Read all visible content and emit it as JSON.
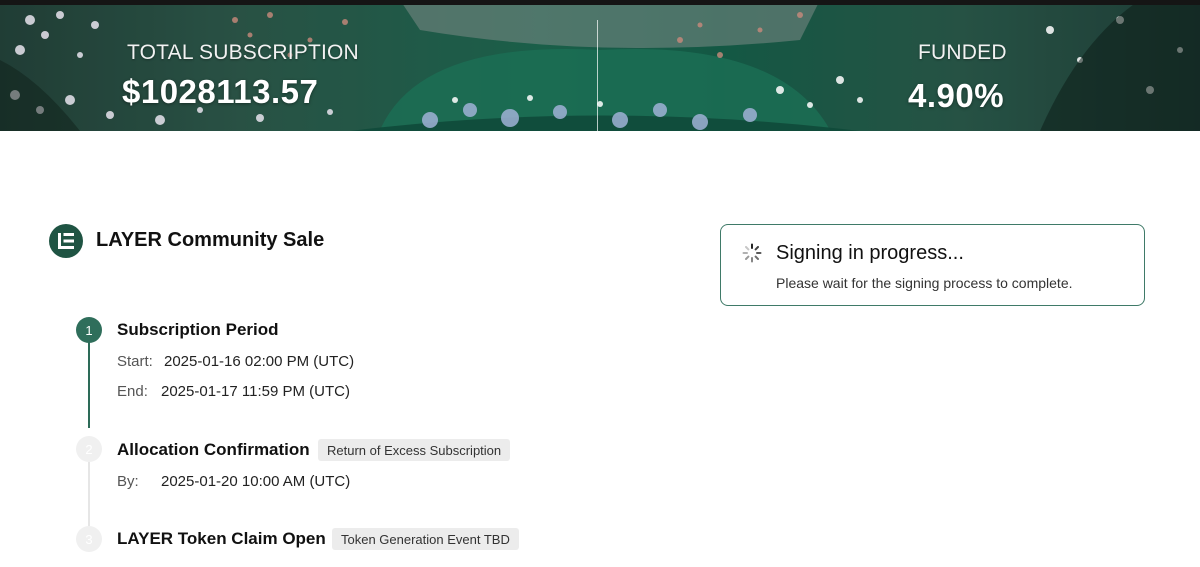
{
  "banner": {
    "total_subscription_label": "TOTAL SUBSCRIPTION",
    "total_subscription_value": "$1028113.57",
    "funded_label": "FUNDED",
    "funded_value": "4.90%",
    "funded_fraction": 0.049
  },
  "sale": {
    "title": "LAYER Community Sale",
    "logo_icon": "layer-logo-icon"
  },
  "steps": [
    {
      "number": "1",
      "title": "Subscription Period",
      "status": "active",
      "rows": [
        {
          "label": "Start:",
          "value": "2025-01-16 02:00 PM (UTC)"
        },
        {
          "label": "End:",
          "value": "2025-01-17 11:59 PM (UTC)"
        }
      ]
    },
    {
      "number": "2",
      "title": "Allocation Confirmation",
      "status": "pending",
      "tag": "Return of Excess Subscription",
      "rows": [
        {
          "label": "By:",
          "value": "2025-01-20 10:00 AM (UTC)"
        }
      ]
    },
    {
      "number": "3",
      "title": "LAYER Token Claim Open",
      "status": "pending",
      "tag": "Token Generation Event TBD"
    }
  ],
  "signing": {
    "title": "Signing in progress...",
    "message": "Please wait for the signing process to complete.",
    "icon": "spinner-icon"
  },
  "colors": {
    "accent": "#2f6e5b",
    "logo_bg": "#1f5443",
    "card_border": "#3f7a68",
    "tag_bg": "#ececec",
    "inactive_step": "#f0f0f0"
  }
}
